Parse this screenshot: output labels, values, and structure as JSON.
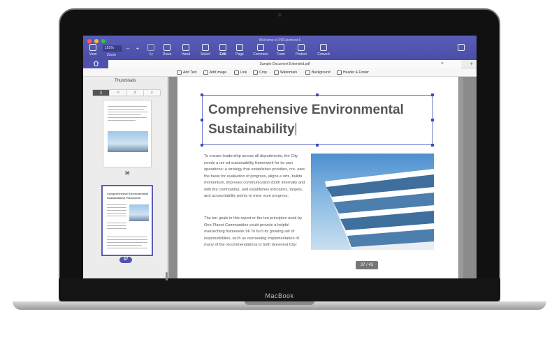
{
  "window": {
    "title": "Welcome to PDFelement 6",
    "zoom": "161%",
    "zoom_label": "Zoom"
  },
  "toolbar": {
    "view": "View",
    "up": "Up",
    "down": "Down",
    "hand": "Hand",
    "select": "Select",
    "edit": "Edit",
    "page": "Page",
    "comment": "Comment",
    "form": "Form",
    "protect": "Protect",
    "convert": "Convert"
  },
  "tabs": {
    "home_icon": "home-icon",
    "document": "Sample Document Extended.pdf",
    "close": "×",
    "add": "+"
  },
  "edit_tools": {
    "add_text": "Add Text",
    "add_image": "Add Image",
    "link": "Link",
    "crop": "Crop",
    "watermark": "Watermark",
    "background": "Background",
    "header_footer": "Header & Footer"
  },
  "sidebar": {
    "title": "Thumbnails",
    "thumbs": [
      {
        "page": "36"
      },
      {
        "page": "37",
        "heading": "Comprehensive Environmental Sustainability Framework"
      }
    ]
  },
  "document": {
    "headline_line1": "Comprehensive Environmental",
    "headline_line2": "Sustainability",
    "paragraph1": "To ensure leadership across all departments, the City needs a uni ed sustainability framework for its own operations: a strategy that establishes priorities, cre- ates the basis for evaluation of progress, aligns e orts, builds momentum, improves communication (both internally and with the community), and establishes indicators, targets, and accountability points to mea- sure progress.",
    "paragraph2": "The ten goals in this report or the ten principles used by One Planet Communities could provide a helpful overarching framework.96 To ful ll its growing set of responsibilities, such as overseeing implementation of many of the recommendations in both Greenest City:",
    "page_indicator": "37 / 45"
  },
  "device": {
    "brand": "MacBook"
  },
  "colors": {
    "accent": "#4f52ad",
    "selection": "#3b4bb5"
  }
}
